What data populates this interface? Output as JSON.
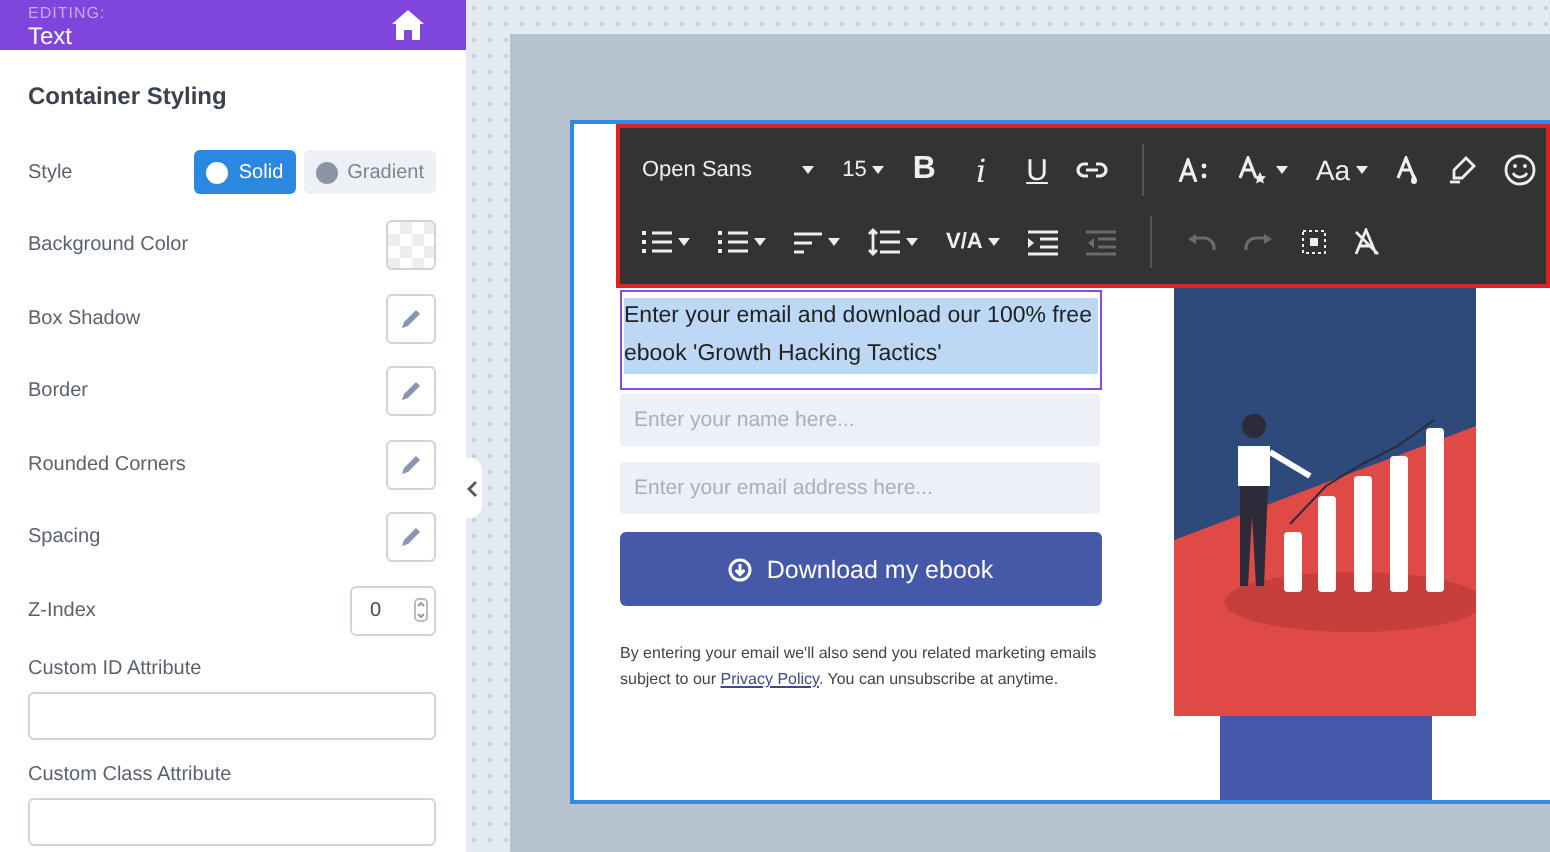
{
  "header": {
    "caption": "EDITING:",
    "title": "Text"
  },
  "sidebar": {
    "heading": "Container Styling",
    "rows": [
      {
        "kind": "toggle",
        "label": "Style",
        "options": [
          {
            "label": "Solid",
            "selected": true
          },
          {
            "label": "Gradient",
            "selected": false
          }
        ]
      },
      {
        "kind": "swatch",
        "label": "Background Color"
      },
      {
        "kind": "edit",
        "label": "Box Shadow"
      },
      {
        "kind": "edit",
        "label": "Border"
      },
      {
        "kind": "edit",
        "label": "Rounded Corners"
      },
      {
        "kind": "edit",
        "label": "Spacing"
      },
      {
        "kind": "number",
        "label": "Z-Index",
        "value": "0"
      },
      {
        "kind": "field",
        "label": "Custom ID Attribute"
      },
      {
        "kind": "field",
        "label": "Custom Class Attribute"
      }
    ]
  },
  "toolbar": {
    "formatting": [
      {
        "kind": "font",
        "label": "Open Sans"
      },
      {
        "kind": "font-size",
        "label": "15"
      },
      {
        "kind": "bold",
        "label": "B"
      },
      {
        "kind": "italic",
        "label": "i"
      },
      {
        "kind": "underline",
        "label": "U"
      },
      {
        "kind": "link"
      },
      {
        "kind": "divider"
      },
      {
        "kind": "size"
      },
      {
        "kind": "special"
      },
      {
        "kind": "case",
        "label": "Aa"
      },
      {
        "kind": "color"
      },
      {
        "kind": "highlight"
      },
      {
        "kind": "emoji"
      }
    ],
    "paragraph": [
      {
        "kind": "ordered",
        "disabled": false
      },
      {
        "kind": "bullets",
        "disabled": false
      },
      {
        "kind": "align",
        "disabled": false
      },
      {
        "kind": "line-height",
        "disabled": false
      },
      {
        "kind": "spacing",
        "label": "V/A",
        "disabled": false
      },
      {
        "kind": "indent",
        "disabled": false
      },
      {
        "kind": "outdent",
        "disabled": true
      },
      {
        "kind": "divider"
      },
      {
        "kind": "undo",
        "disabled": true
      },
      {
        "kind": "redo",
        "disabled": true
      },
      {
        "kind": "select-all",
        "disabled": false
      },
      {
        "kind": "clear",
        "disabled": false
      }
    ]
  },
  "form": {
    "headline": "Enter your email and download our 100% free ebook 'Growth Hacking Tactics'",
    "headline_selected": true,
    "fields": [
      {
        "placeholder": "Enter your name here..."
      },
      {
        "placeholder": "Enter your email address here..."
      }
    ],
    "button": "Download my ebook",
    "disclaimer": {
      "before": "By entering your email we'll also send you related marketing emails subject to our",
      "link": "Privacy Policy",
      "after": ". You can unsubscribe at anytime."
    }
  }
}
